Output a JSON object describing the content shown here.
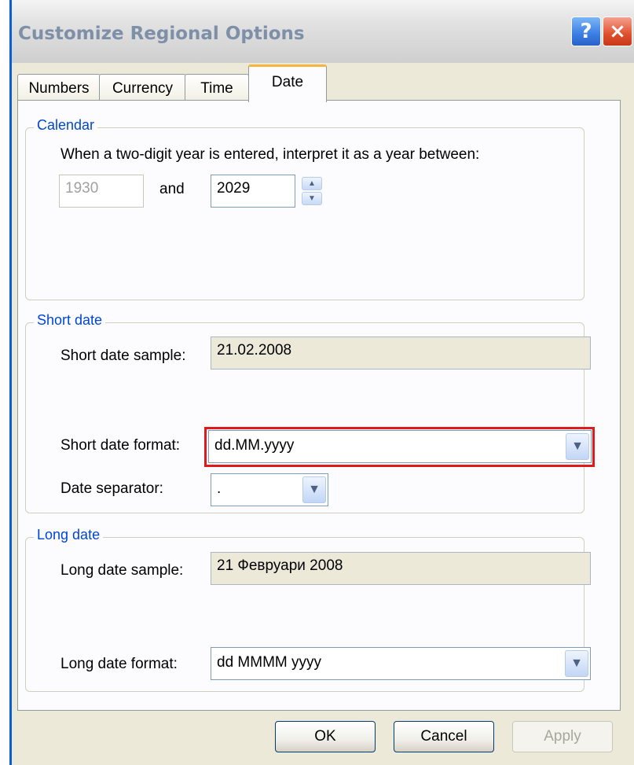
{
  "window": {
    "title": "Customize Regional Options"
  },
  "titlebar": {
    "help_glyph": "?",
    "close_glyph": "×"
  },
  "tabs": [
    {
      "label": "Numbers",
      "active": false
    },
    {
      "label": "Currency",
      "active": false
    },
    {
      "label": "Time",
      "active": false
    },
    {
      "label": "Date",
      "active": true
    }
  ],
  "calendar": {
    "legend": "Calendar",
    "prompt": "When a two-digit year is entered, interpret it as a year between:",
    "start_year": "1930",
    "and_label": "and",
    "end_year": "2029"
  },
  "short_date": {
    "legend": "Short date",
    "sample_label": "Short date sample:",
    "sample_value": "21.02.2008",
    "format_label": "Short date format:",
    "format_value": "dd.MM.yyyy",
    "separator_label": "Date separator:",
    "separator_value": "."
  },
  "long_date": {
    "legend": "Long date",
    "sample_label": "Long date sample:",
    "sample_value": "21 Февруари 2008",
    "format_label": "Long date format:",
    "format_value": "dd MMMM yyyy"
  },
  "buttons": {
    "ok": "OK",
    "cancel": "Cancel",
    "apply": "Apply"
  },
  "icons": {
    "spin_up": "▲",
    "spin_down": "▼",
    "dropdown": "▼"
  },
  "colors": {
    "title_bar_text": "#7e8fa8",
    "group_legend": "#0046d5",
    "highlight_border": "#e0191b",
    "active_tab_accent": "#f5b53f"
  }
}
